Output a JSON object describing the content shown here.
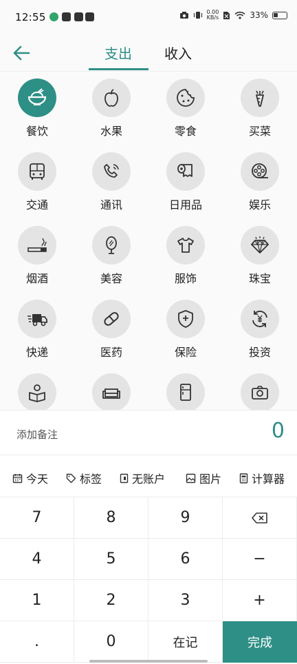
{
  "status_bar": {
    "time": "12:55",
    "net_speed_value": "0.00",
    "net_speed_unit": "KB/s",
    "battery": "33%"
  },
  "header": {
    "tabs": [
      {
        "label": "支出",
        "active": true
      },
      {
        "label": "收入",
        "active": false
      }
    ],
    "accent_color": "#2e8f86"
  },
  "categories": [
    {
      "label": "餐饮",
      "icon": "rice-bowl-icon",
      "selected": true
    },
    {
      "label": "水果",
      "icon": "apple-icon"
    },
    {
      "label": "零食",
      "icon": "cookie-icon"
    },
    {
      "label": "买菜",
      "icon": "carrot-icon"
    },
    {
      "label": "交通",
      "icon": "bus-icon"
    },
    {
      "label": "通讯",
      "icon": "phone-icon"
    },
    {
      "label": "日用品",
      "icon": "toilet-paper-icon"
    },
    {
      "label": "娱乐",
      "icon": "film-reel-icon"
    },
    {
      "label": "烟酒",
      "icon": "cigarette-icon"
    },
    {
      "label": "美容",
      "icon": "mirror-icon"
    },
    {
      "label": "服饰",
      "icon": "tshirt-icon"
    },
    {
      "label": "珠宝",
      "icon": "diamond-icon"
    },
    {
      "label": "快递",
      "icon": "delivery-truck-icon"
    },
    {
      "label": "医药",
      "icon": "pill-icon"
    },
    {
      "label": "保险",
      "icon": "shield-plus-icon"
    },
    {
      "label": "投资",
      "icon": "yen-cycle-icon"
    },
    {
      "label": "",
      "icon": "reading-person-icon"
    },
    {
      "label": "",
      "icon": "sofa-icon"
    },
    {
      "label": "",
      "icon": "refrigerator-icon"
    },
    {
      "label": "",
      "icon": "camera-icon"
    }
  ],
  "note": {
    "placeholder": "添加备注",
    "amount": "0"
  },
  "options": [
    {
      "label": "今天",
      "icon": "calendar-icon"
    },
    {
      "label": "标签",
      "icon": "tag-icon"
    },
    {
      "label": "无账户",
      "icon": "wallet-icon"
    },
    {
      "label": "图片",
      "icon": "image-icon"
    },
    {
      "label": "计算器",
      "icon": "calculator-icon"
    }
  ],
  "keypad": {
    "keys": [
      "7",
      "8",
      "9",
      "⌫",
      "4",
      "5",
      "6",
      "−",
      "1",
      "2",
      "3",
      "+",
      ".",
      "0",
      "在记",
      "完成"
    ]
  }
}
